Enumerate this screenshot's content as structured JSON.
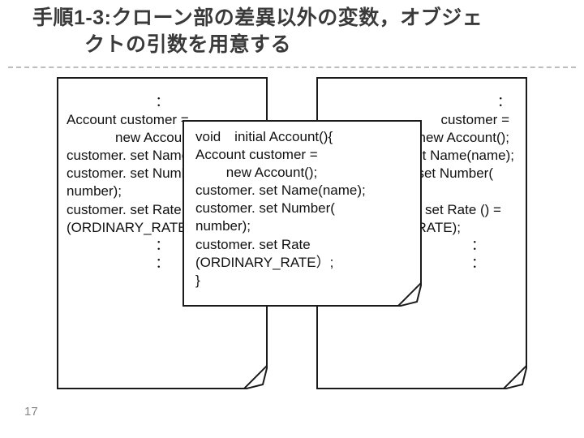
{
  "title_line1": "手順1-3:クローン部の差異以外の変数，オブジェ",
  "title_line2": "クトの引数を用意する",
  "page_number": "17",
  "card_left": [
    "",
    "：",
    "Account customer =",
    "new Account();",
    "customer. set Name(name);",
    "customer. set Number(",
    "number);",
    "customer. set Rate",
    "(ORDINARY_RATE）;",
    "：",
    "："
  ],
  "card_right": [
    "",
    "：",
    "customer =",
    "new Account();",
    "er. set Name(name);",
    "er. set Number(",
    ";",
    "er. set Rate () =",
    "RATE);",
    "：",
    "："
  ],
  "card_overlay": [
    "void　initial Account(){",
    "Account customer =",
    "        new Account();",
    "customer. set Name(name);",
    "customer. set Number(",
    "number);",
    "customer. set Rate",
    "(ORDINARY_RATE）;",
    "}"
  ]
}
